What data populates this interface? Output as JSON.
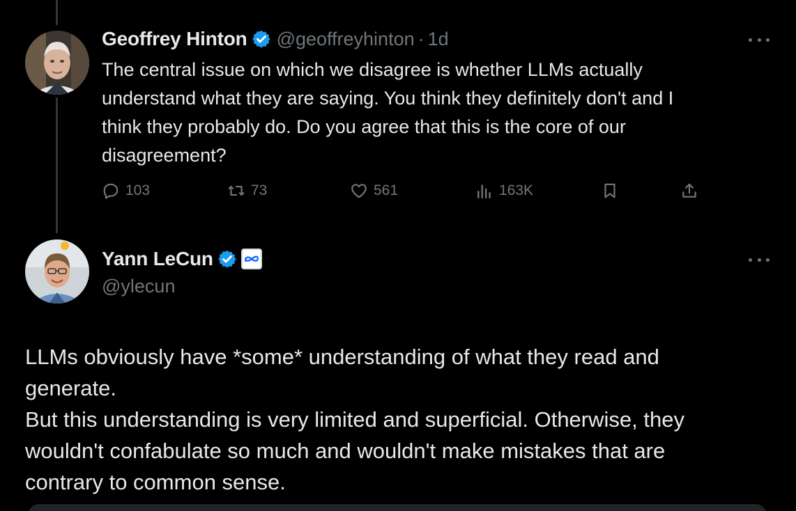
{
  "tweets": [
    {
      "author": {
        "name": "Geoffrey Hinton",
        "handle": "@geoffreyhinton",
        "verified": true
      },
      "separator": "·",
      "time": "1d",
      "text_lines": [
        "The central issue on which we disagree is whether LLMs actually",
        "understand what they are saying. You think they definitely don't and I",
        "think they probably do. Do you agree that this is the core of our",
        "disagreement?"
      ],
      "actions": {
        "replies": "103",
        "reposts": "73",
        "likes": "561",
        "views": "163K"
      },
      "icons": [
        "reply-icon",
        "repost-icon",
        "like-icon",
        "views-icon",
        "bookmark-icon",
        "share-icon"
      ]
    },
    {
      "author": {
        "name": "Yann LeCun",
        "handle": "@ylecun",
        "verified": true,
        "affiliate": "meta-logo"
      },
      "text_lines": [
        "LLMs obviously have *some* understanding of what they read and",
        "generate.",
        "But this understanding is very limited and superficial. Otherwise, they",
        "wouldn't confabulate so much and wouldn't make mistakes that are",
        "contrary to common sense."
      ]
    }
  ],
  "colors": {
    "background": "#000000",
    "text": "#e7e9ea",
    "muted": "#71767b",
    "verified_blue": "#1d9bf0"
  }
}
